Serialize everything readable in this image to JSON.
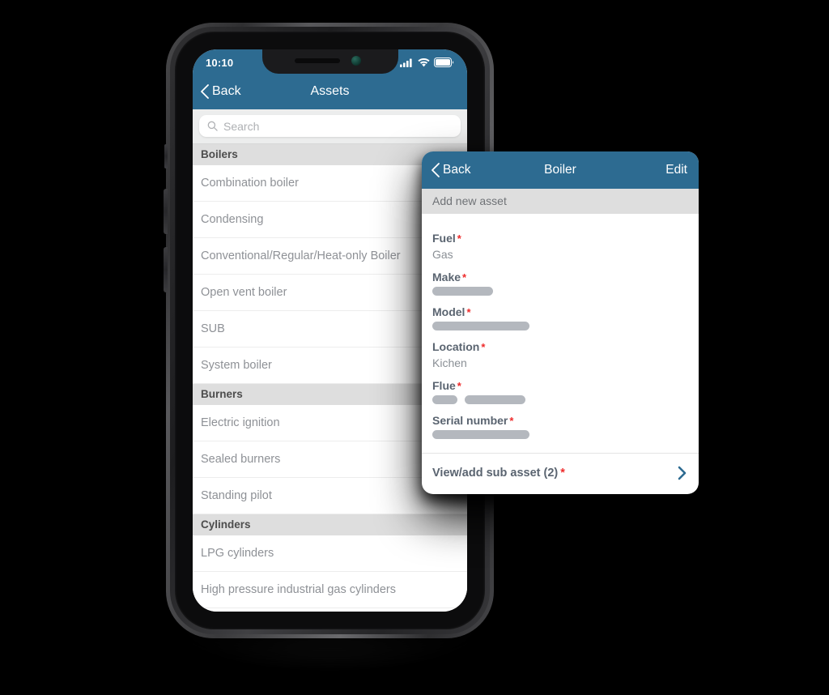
{
  "theme": {
    "nav_blue": "#2d6b91",
    "section_gray": "#dedede",
    "required_red": "#ee2b2b",
    "label_gray": "#5a6470",
    "list_text_gray": "#8e9196",
    "redact_gray": "#b4b8be",
    "chevron_blue": "#2d6b91"
  },
  "phone": {
    "status_bar": {
      "time": "10:10",
      "icons": [
        "cellular-signal-icon",
        "wifi-icon",
        "battery-icon"
      ]
    },
    "nav": {
      "back_label": "Back",
      "back_icon": "chevron-left-icon",
      "title": "Assets"
    },
    "search": {
      "icon": "search-icon",
      "placeholder": "Search",
      "value": ""
    },
    "sections": [
      {
        "header": "Boilers",
        "items": [
          "Combination boiler",
          "Condensing",
          "Conventional/Regular/Heat-only Boiler",
          "Open vent boiler",
          "SUB",
          "System boiler"
        ]
      },
      {
        "header": "Burners",
        "items": [
          "Electric ignition",
          "Sealed burners",
          "Standing pilot"
        ]
      },
      {
        "header": "Cylinders",
        "items": [
          "LPG cylinders",
          "High pressure industrial gas cylinders"
        ]
      }
    ]
  },
  "detail_card": {
    "nav": {
      "back_label": "Back",
      "back_icon": "chevron-left-icon",
      "title": "Boiler",
      "edit_label": "Edit"
    },
    "subheader": "Add new asset",
    "fields": [
      {
        "label": "Fuel",
        "required": "*",
        "kind": "text",
        "value": "Gas"
      },
      {
        "label": "Make",
        "required": "*",
        "kind": "redact",
        "bars": [
          75
        ]
      },
      {
        "label": "Model",
        "required": "*",
        "kind": "redact",
        "bars": [
          120
        ]
      },
      {
        "label": "Location",
        "required": "*",
        "kind": "text",
        "value": "Kichen"
      },
      {
        "label": "Flue",
        "required": "*",
        "kind": "redact",
        "bars": [
          31,
          75
        ]
      },
      {
        "label": "Serial number",
        "required": "*",
        "kind": "redact",
        "bars": [
          120
        ]
      }
    ],
    "footer": {
      "label": "View/add sub asset (2)",
      "required": "*",
      "icon": "chevron-right-icon"
    }
  }
}
